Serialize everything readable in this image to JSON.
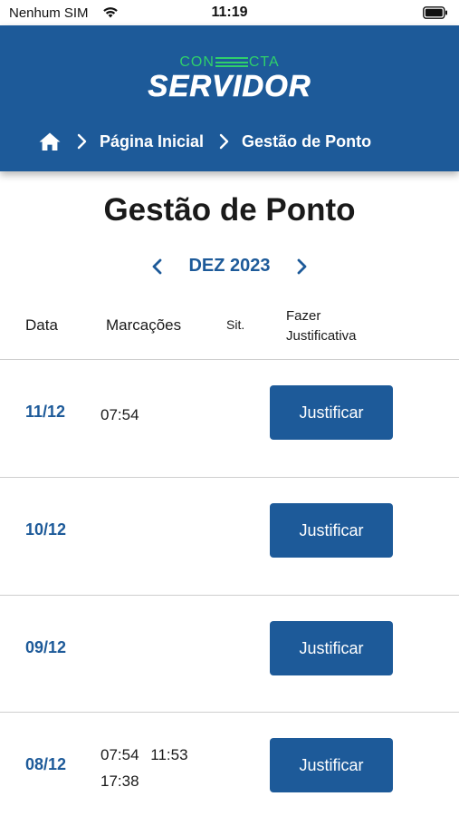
{
  "status_bar": {
    "carrier": "Nenhum SIM",
    "time": "11:19"
  },
  "header": {
    "logo_top_left": "CON",
    "logo_top_right": "CTA",
    "logo_main": "SERVIDOR",
    "background_color": "#1d5a99",
    "logo_accent_color": "#2fd06b"
  },
  "breadcrumb": {
    "items": [
      "Página Inicial",
      "Gestão de Ponto"
    ]
  },
  "page": {
    "title": "Gestão de Ponto"
  },
  "month_selector": {
    "label": "DEZ 2023"
  },
  "table": {
    "columns": {
      "date": "Data",
      "marks": "Marcações",
      "situation": "Sit.",
      "justify_line1": "Fazer",
      "justify_line2": "Justificativa"
    },
    "rows": [
      {
        "date": "11/12",
        "marks": "07:54",
        "situation": "",
        "button": "Justificar"
      },
      {
        "date": "10/12",
        "marks": "",
        "situation": "",
        "button": "Justificar"
      },
      {
        "date": "09/12",
        "marks": "",
        "situation": "",
        "button": "Justificar"
      },
      {
        "date": "08/12",
        "marks": "07:54 11:53 17:38",
        "situation": "",
        "button": "Justificar"
      }
    ]
  }
}
